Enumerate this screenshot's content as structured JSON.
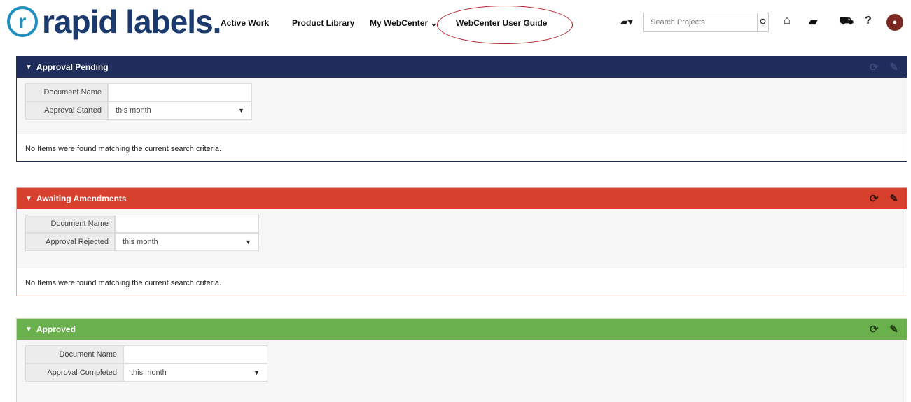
{
  "brand": {
    "mark": "r",
    "name": "rapid labels."
  },
  "nav": {
    "active_work": "Active Work",
    "product_library": "Product Library",
    "my_webcenter": "My WebCenter",
    "my_webcenter_caret": "⌄",
    "user_guide": "WebCenter User Guide"
  },
  "search": {
    "placeholder": "Search Projects",
    "icon": "search-icon"
  },
  "header_icons": [
    "projects-menu-icon",
    "home-icon",
    "chat-icon",
    "cart-icon",
    "help-icon",
    "avatar"
  ],
  "colors": {
    "pending": "#1f2d5c",
    "amendments": "#d8402e",
    "approved": "#6ab04c",
    "highlight": "#b5202a"
  },
  "panels": {
    "pending": {
      "title": "Approval Pending",
      "filters": [
        {
          "label": "Document Name",
          "value": ""
        },
        {
          "label": "Approval Started",
          "value": "this month"
        }
      ],
      "message": "No Items were found matching the current search criteria."
    },
    "amendments": {
      "title": "Awaiting Amendments",
      "filters": [
        {
          "label": "Document Name",
          "value": ""
        },
        {
          "label": "Approval Rejected",
          "value": "this month"
        }
      ],
      "message": "No Items were found matching the current search criteria."
    },
    "approved": {
      "title": "Approved",
      "filters": [
        {
          "label": "Document Name",
          "value": ""
        },
        {
          "label": "Approval Completed",
          "value": "this month"
        }
      ]
    }
  }
}
